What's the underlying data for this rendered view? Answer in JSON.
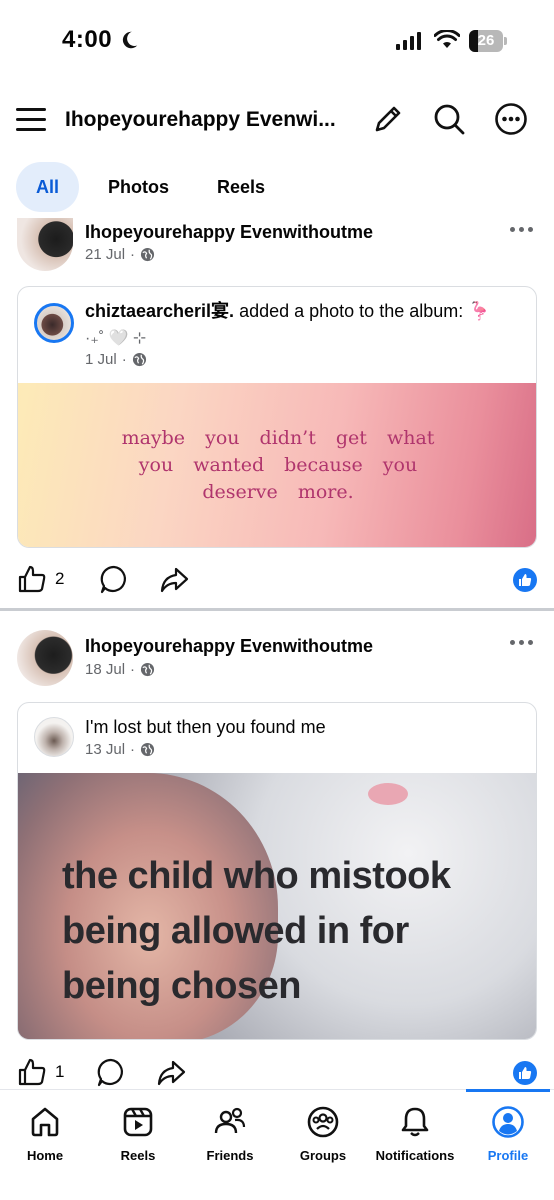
{
  "status_bar": {
    "time": "4:00",
    "battery": "26"
  },
  "header": {
    "title": "Ihopeyourehappy Evenwi..."
  },
  "tabs": [
    {
      "label": "All",
      "active": true
    },
    {
      "label": "Photos",
      "active": false
    },
    {
      "label": "Reels",
      "active": false
    }
  ],
  "posts": [
    {
      "author": "Ihopeyourehappy Evenwithoutme",
      "date": "21 Jul",
      "shared": {
        "author": "chiztaearcheril宴.",
        "action": " added a photo to the album: 🦩",
        "action_line2": "·₊˚ 🤍 ⊹",
        "date": "1 Jul",
        "image_text": "maybe you didn’t get what you wanted because you deserve more."
      },
      "likes": "2"
    },
    {
      "author": "Ihopeyourehappy Evenwithoutme",
      "date": "18 Jul",
      "shared": {
        "author": "I'm lost but then you found me",
        "date": "13 Jul",
        "image_text_lines": [
          "the child who mistook",
          "being allowed in for",
          "being chosen"
        ]
      },
      "likes": "1"
    }
  ],
  "bottom_nav": [
    {
      "label": "Home",
      "icon": "home-icon"
    },
    {
      "label": "Reels",
      "icon": "reels-icon"
    },
    {
      "label": "Friends",
      "icon": "friends-icon"
    },
    {
      "label": "Groups",
      "icon": "groups-icon"
    },
    {
      "label": "Notifications",
      "icon": "bell-icon"
    },
    {
      "label": "Profile",
      "icon": "profile-icon",
      "active": true
    }
  ],
  "colors": {
    "accent": "#1877f2",
    "tab_active_bg": "#e3edfb",
    "quote_text": "#b0356d"
  }
}
